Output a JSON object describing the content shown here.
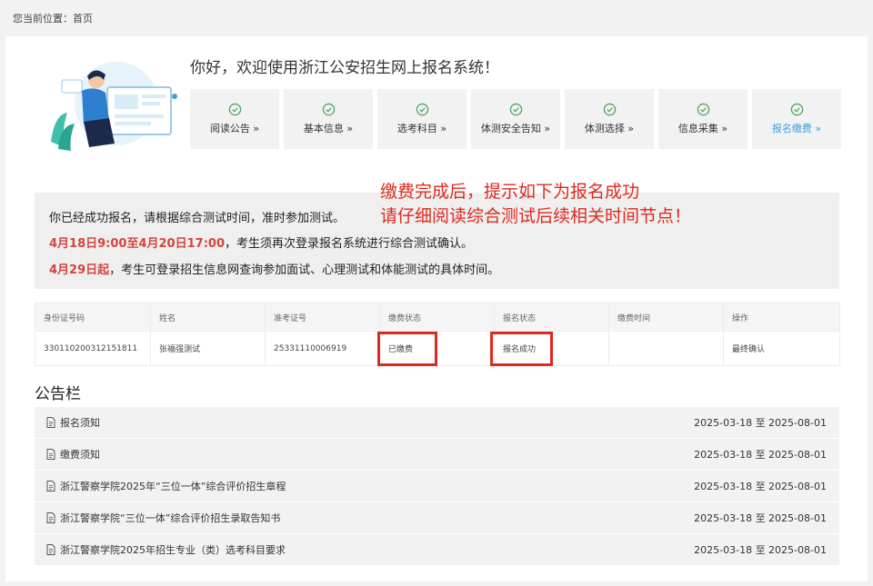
{
  "breadcrumb": "您当前位置：首页",
  "welcome": "你好，欢迎使用浙江公安招生网上报名系统！",
  "steps": [
    {
      "label": "阅读公告 »",
      "current": false
    },
    {
      "label": "基本信息 »",
      "current": false
    },
    {
      "label": "选考科目 »",
      "current": false
    },
    {
      "label": "体测安全告知 »",
      "current": false
    },
    {
      "label": "体测选择 »",
      "current": false
    },
    {
      "label": "信息采集 »",
      "current": false
    },
    {
      "label": "报名缴费 »",
      "current": true
    }
  ],
  "notice": {
    "line1": "你已经成功报名，请根据综合测试时间，准时参加测试。",
    "line2_red": "4月18日9:00至4月20日17:00",
    "line2_rest": "，考生须再次登录报名系统进行综合测试确认。",
    "line3_red": "4月29日起",
    "line3_rest": "，考生可登录招生信息网查询参加面试、心理测试和体能测试的具体时间。"
  },
  "annotation": {
    "line1": "缴费完成后，提示如下为报名成功",
    "line2": "请仔细阅读综合测试后续相关时间节点！"
  },
  "table": {
    "headers": [
      "身份证号码",
      "姓名",
      "准考证号",
      "缴费状态",
      "报名状态",
      "缴费时间",
      "操作"
    ],
    "row": {
      "id_number": "330110200312151811",
      "name": "张福强测试",
      "exam_no": "25331110006919",
      "pay_status": "已缴费",
      "reg_status": "报名成功",
      "pay_time": "",
      "action": "最终确认"
    }
  },
  "bulletin": {
    "title": "公告栏",
    "items": [
      {
        "title": "报名须知",
        "date": "2025-03-18 至 2025-08-01"
      },
      {
        "title": "缴费须知",
        "date": "2025-03-18 至 2025-08-01"
      },
      {
        "title": "浙江警察学院2025年“三位一体”综合评价招生章程",
        "date": "2025-03-18 至 2025-08-01"
      },
      {
        "title": "浙江警察学院“三位一体”综合评价招生录取告知书",
        "date": "2025-03-18 至 2025-08-01"
      },
      {
        "title": "浙江警察学院2025年招生专业（类）选考科目要求",
        "date": "2025-03-18 至 2025-08-01"
      }
    ]
  },
  "colors": {
    "accent_blue": "#3d9fdc",
    "alert_red": "#d4453d",
    "check_green": "#52a462",
    "success_orange": "#e6a23c"
  }
}
